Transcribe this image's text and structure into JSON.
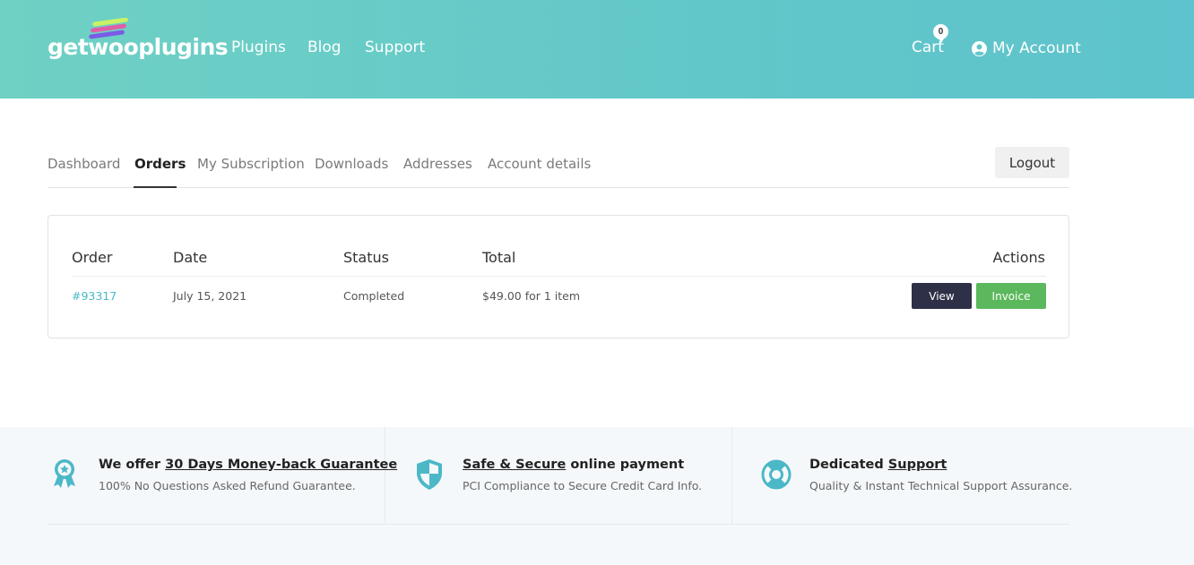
{
  "header": {
    "logo_text": "getwooplugins",
    "nav": [
      "Plugins",
      "Blog",
      "Support"
    ],
    "cart_label": "Cart",
    "cart_count": "0",
    "account_label": "My Account"
  },
  "tabs": {
    "items": [
      "Dashboard",
      "Orders",
      "My Subscription",
      "Downloads",
      "Addresses",
      "Account details"
    ],
    "active": "Orders",
    "logout_label": "Logout"
  },
  "orders": {
    "columns": [
      "Order",
      "Date",
      "Status",
      "Total",
      "Actions"
    ],
    "rows": [
      {
        "order": "#93317",
        "date": "July 15, 2021",
        "status": "Completed",
        "total": "$49.00 for 1 item",
        "actions": [
          "View",
          "Invoice"
        ]
      }
    ]
  },
  "features": [
    {
      "icon": "award-ribbon-icon",
      "title_prefix": "We offer ",
      "title_link": "30 Days Money-back Guarantee",
      "title_suffix": "",
      "subtitle": "100% No Questions Asked Refund Guarantee."
    },
    {
      "icon": "shield-icon",
      "title_prefix": "",
      "title_link": "Safe & Secure",
      "title_suffix": " online payment",
      "subtitle": "PCI Compliance to Secure Credit Card Info."
    },
    {
      "icon": "lifebuoy-icon",
      "title_prefix": "Dedicated ",
      "title_link": "Support",
      "title_suffix": "",
      "subtitle": "Quality & Instant Technical Support Assurance."
    }
  ],
  "colors": {
    "header_gradient_start": "#6fd1c4",
    "header_gradient_end": "#5ec3cc",
    "link": "#4bb8c7",
    "view_button": "#2d3047",
    "invoice_button": "#5cb85c",
    "feature_icon": "#4bb8c7"
  }
}
